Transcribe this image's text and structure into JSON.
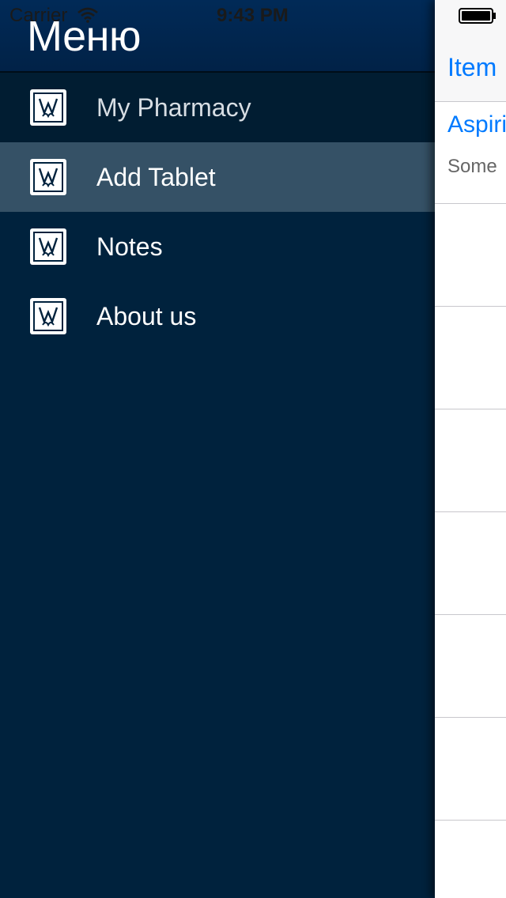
{
  "status_bar": {
    "carrier": "Carrier",
    "time": "9:43 PM"
  },
  "menu": {
    "title": "Меню",
    "items": [
      {
        "label": "My Pharmacy",
        "icon": "pharmacy-logo-icon"
      },
      {
        "label": "Add Tablet",
        "icon": "pharmacy-logo-icon",
        "selected": true
      },
      {
        "label": "Notes",
        "icon": "pharmacy-logo-icon"
      },
      {
        "label": "About us",
        "icon": "pharmacy-logo-icon"
      }
    ]
  },
  "content": {
    "nav_title": "Item",
    "rows": [
      {
        "title": "Aspiri",
        "subtitle": "Some"
      }
    ]
  },
  "colors": {
    "menu_background": "#00223d",
    "menu_selected": "#355166",
    "accent": "#007aff"
  }
}
